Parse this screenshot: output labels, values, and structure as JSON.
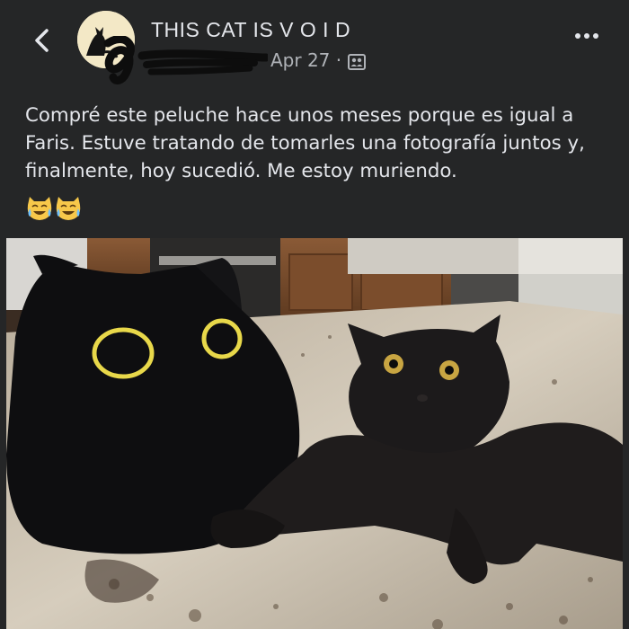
{
  "header": {
    "back_icon": "chevron-left-icon",
    "group_name": "THIS CAT IS V O I D",
    "date": "Apr 27",
    "separator": "·",
    "audience_icon": "group-audience-icon",
    "more_icon": "more-horizontal-icon"
  },
  "post": {
    "text": "Compré este peluche hace unos meses porque es igual a Faris. Estuve tratando de tomarles una fotografía juntos y, finalmente, hoy sucedió. Me estoy muriendo.",
    "emojis": "😹😹",
    "photo_subject": "black-cat-and-plush"
  },
  "colors": {
    "background": "#252627",
    "text": "#e4e6eb",
    "meta": "#b0b3b8"
  }
}
